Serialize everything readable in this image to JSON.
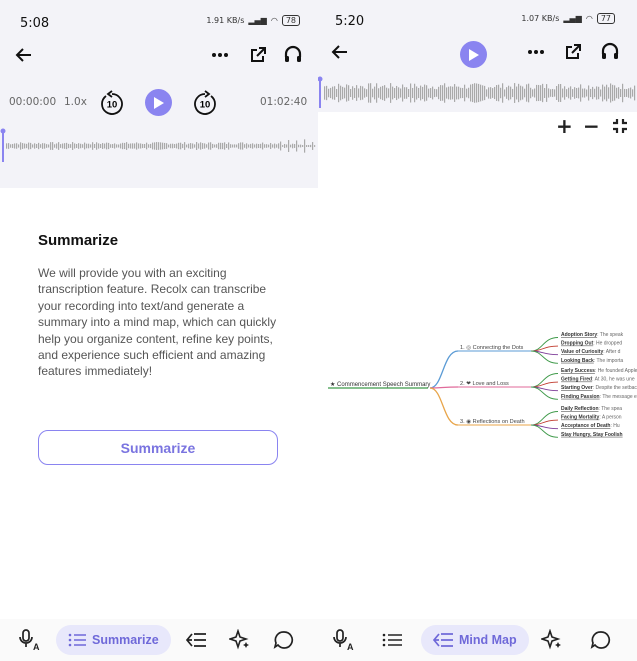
{
  "left": {
    "status": {
      "time": "5:08",
      "speed": "1.91 KB/s",
      "battery": "78"
    },
    "player": {
      "current": "00:00:00",
      "speed": "1.0x",
      "rewind": "10",
      "forward": "10",
      "total": "01:02:40"
    },
    "summary": {
      "title": "Summarize",
      "body": "We will provide you with an exciting transcription feature. Recolx can transcribe your recording into text/and generate a summary into a mind map, which can quickly help you organize content, refine key points, and experience such efficient and amazing features immediately!",
      "button": "Summarize"
    },
    "nav": {
      "active_label": "Summarize"
    }
  },
  "right": {
    "status": {
      "time": "5:20",
      "speed": "1.07 KB/s",
      "battery": "77"
    },
    "zoom": {
      "in": "+",
      "out": "−"
    },
    "mindmap": {
      "root": "Commencement Speech Summary",
      "branches": [
        {
          "label": "1. ◎ Connecting the Dots",
          "color": "#5b9bd5",
          "leaves": [
            {
              "bold": "Adoption Story",
              "text": ": The speak"
            },
            {
              "bold": "Dropping Out",
              "text": ": He dropped"
            },
            {
              "bold": "Value of Curiosity",
              "text": ": After d"
            },
            {
              "bold": "Looking Back",
              "text": ": The importa"
            }
          ]
        },
        {
          "label": "2. ❤ Love and Loss",
          "color": "#e06a9a",
          "leaves": [
            {
              "bold": "Early Success",
              "text": ": He founded Apple"
            },
            {
              "bold": "Getting Fired",
              "text": ": At 30, he was une"
            },
            {
              "bold": "Starting Over",
              "text": ": Despite the setbac"
            },
            {
              "bold": "Finding Passion",
              "text": ": The message e"
            }
          ]
        },
        {
          "label": "3. ◉ Reflections on Death",
          "color": "#e8a54a",
          "leaves": [
            {
              "bold": "Daily Reflection",
              "text": ": The spea"
            },
            {
              "bold": "Facing Mortality",
              "text": ": A person"
            },
            {
              "bold": "Acceptance of Death",
              "text": ": Hu"
            },
            {
              "bold": "Stay Hungry, Stay Foolish",
              "text": ""
            }
          ]
        }
      ]
    },
    "nav": {
      "active_label": "Mind Map"
    }
  },
  "colors": {
    "accent": "#8a84f0",
    "pill_bg": "#e8e8fb",
    "wave": "#a9a9a9"
  }
}
